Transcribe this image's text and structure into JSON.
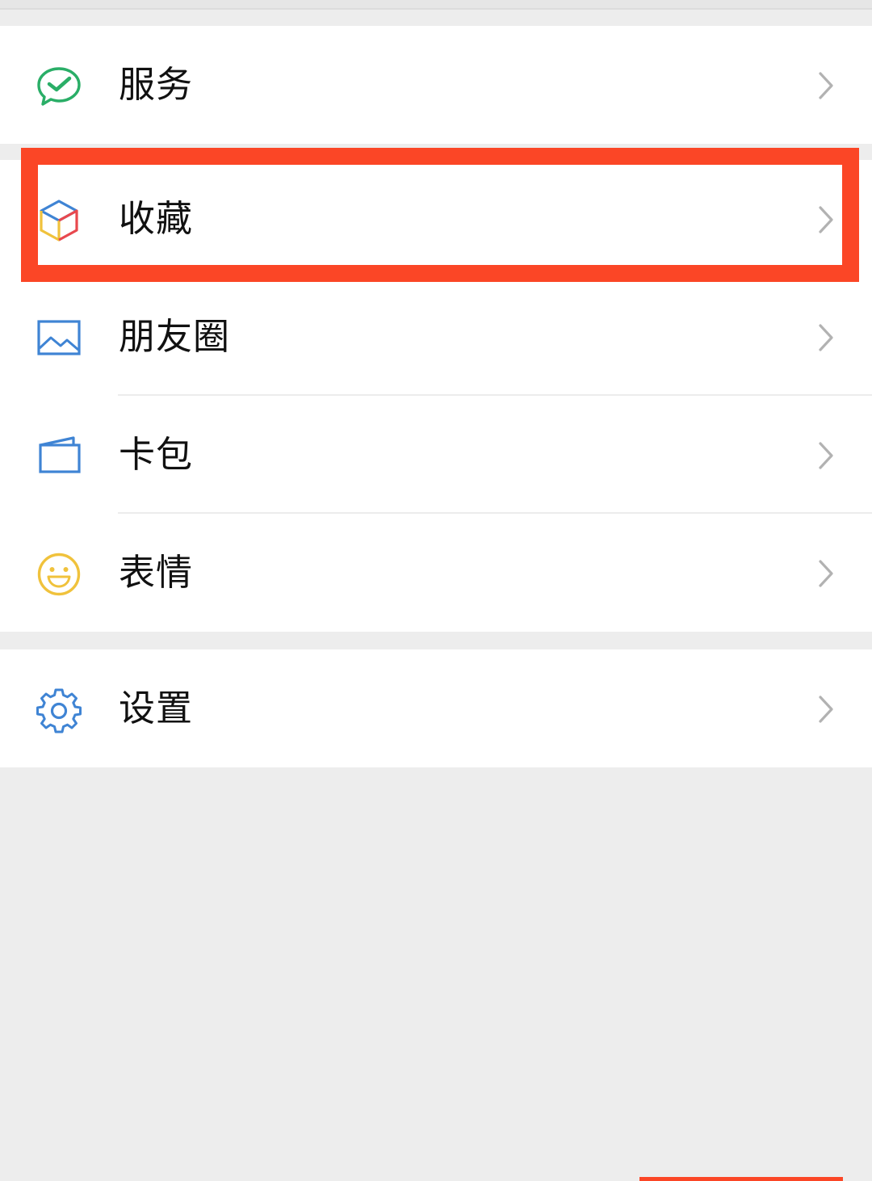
{
  "menu": {
    "services": {
      "label": "服务",
      "icon": "wechat-pay-check-icon",
      "color": "#2aae67"
    },
    "favorites": {
      "label": "收藏",
      "icon": "cube-icon"
    },
    "moments": {
      "label": "朋友圈",
      "icon": "image-landscape-icon",
      "color": "#3f84d4"
    },
    "cards": {
      "label": "卡包",
      "icon": "wallet-icon",
      "color": "#3f84d4"
    },
    "stickers": {
      "label": "表情",
      "icon": "smiley-face-icon",
      "color": "#f0c23c"
    },
    "settings": {
      "label": "设置",
      "icon": "gear-icon",
      "color": "#3f84d4"
    }
  },
  "colors": {
    "background": "#ededed",
    "row_background": "#ffffff",
    "highlight": "#fb4626",
    "chevron": "#b2b2b2",
    "text": "#111111"
  }
}
